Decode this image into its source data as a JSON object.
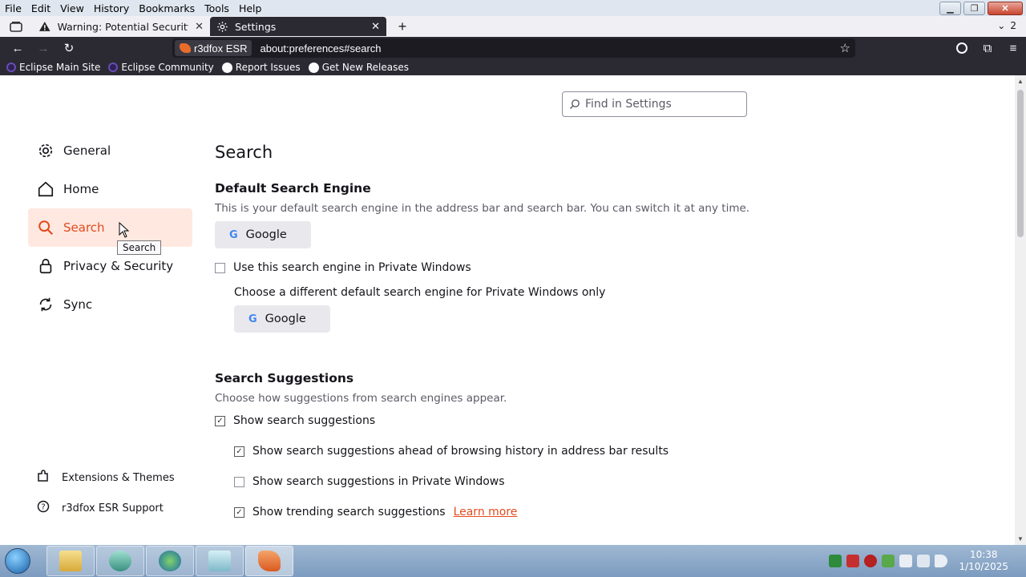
{
  "menu": [
    "File",
    "Edit",
    "View",
    "History",
    "Bookmarks",
    "Tools",
    "Help"
  ],
  "tabs": [
    {
      "title": "Warning: Potential Security Risk Ahead"
    },
    {
      "title": "Settings"
    }
  ],
  "tab_count": "2",
  "urlbar": {
    "identity": "r3dfox ESR",
    "url": "about:preferences#search"
  },
  "bookmarks": [
    "Eclipse Main Site",
    "Eclipse Community",
    "Report Issues",
    "Get New Releases"
  ],
  "search": {
    "placeholder": "Find in Settings"
  },
  "sidebar": {
    "categories": [
      {
        "label": "General",
        "icon": "gear-icon"
      },
      {
        "label": "Home",
        "icon": "home-icon"
      },
      {
        "label": "Search",
        "icon": "search-icon",
        "selected": true
      },
      {
        "label": "Privacy & Security",
        "icon": "lock-icon"
      },
      {
        "label": "Sync",
        "icon": "sync-icon"
      }
    ],
    "tooltip": "Search",
    "footer": [
      {
        "label": "Extensions & Themes",
        "icon": "puzzle-icon"
      },
      {
        "label": "r3dfox ESR Support",
        "icon": "help-icon"
      }
    ]
  },
  "main": {
    "title": "Search",
    "default_engine": {
      "heading": "Default Search Engine",
      "description": "This is your default search engine in the address bar and search bar. You can switch it at any time.",
      "engine": "Google",
      "private_checkbox": "Use this search engine in Private Windows",
      "private_desc": "Choose a different default search engine for Private Windows only",
      "private_engine": "Google"
    },
    "suggestions": {
      "heading": "Search Suggestions",
      "description": "Choose how suggestions from search engines appear.",
      "items": [
        {
          "label": "Show search suggestions",
          "checked": true
        },
        {
          "label": "Show search suggestions ahead of browsing history in address bar results",
          "checked": true
        },
        {
          "label": "Show search suggestions in Private Windows",
          "checked": false
        },
        {
          "label": "Show trending search suggestions",
          "checked": true
        }
      ],
      "learn_more": "Learn more"
    }
  },
  "clock": {
    "time": "10:38",
    "date": "1/10/2025"
  },
  "colors": {
    "accent": "#e24b1e",
    "toolbar": "#2b2a33",
    "selected_bg": "#ffe8e0"
  }
}
